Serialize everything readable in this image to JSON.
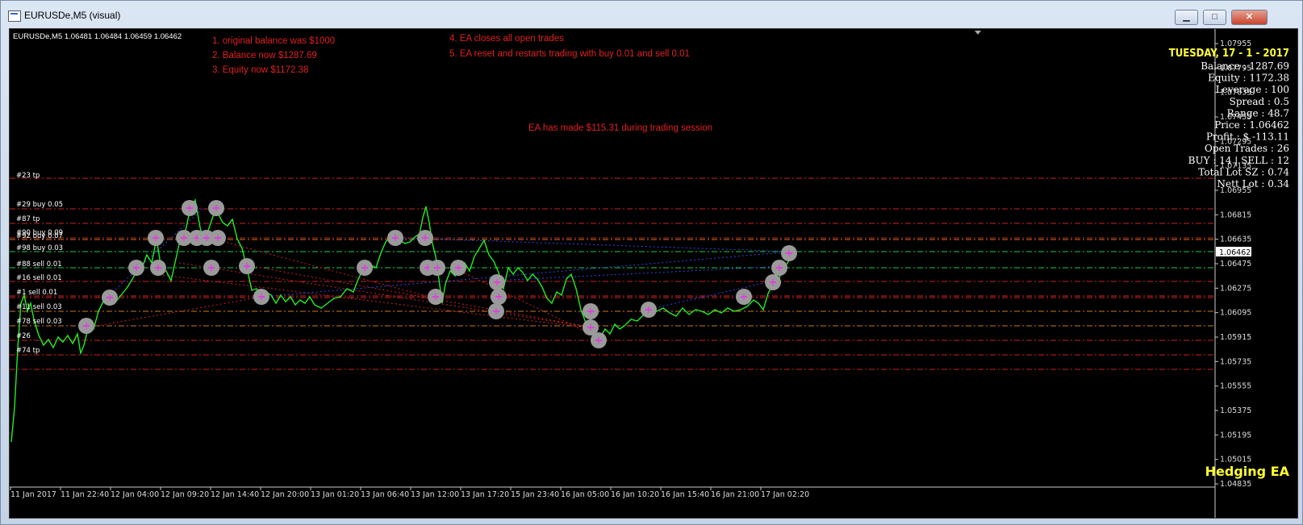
{
  "window": {
    "title": "EURUSDe,M5 (visual)",
    "buttons": {
      "minimize": "▁",
      "maximize": "□",
      "close": "✕"
    }
  },
  "chart": {
    "header": "EURUSDe,M5  1.06481 1.06484 1.06459 1.06462",
    "current_price": "1.06462",
    "y_ticks": [
      "1.07955",
      "1.07795",
      "1.07635",
      "1.07455",
      "1.07295",
      "1.07135",
      "1.06955",
      "1.06815",
      "1.06635",
      "1.06475",
      "1.06275",
      "1.06095",
      "1.05915",
      "1.05735",
      "1.05555",
      "1.05375",
      "1.05195",
      "1.05015",
      "1.04835"
    ],
    "x_ticks": [
      "11 Jan 2017",
      "11 Jan 22:40",
      "12 Jan 04:00",
      "12 Jan 09:20",
      "12 Jan 14:40",
      "12 Jan 20:00",
      "13 Jan 01:20",
      "13 Jan 06:40",
      "13 Jan 12:00",
      "13 Jan 17:20",
      "15 Jan 23:40",
      "16 Jan 05:00",
      "16 Jan 10:20",
      "16 Jan 15:40",
      "16 Jan 21:00",
      "17 Jan 02:20"
    ],
    "order_labels": [
      "#23 tp",
      "#29 buy 0.05",
      "#87 tp",
      "#90 buy 0.09",
      "#92 buy 0.07",
      "#98 buy 0.03",
      "#88 sell 0.01",
      "#16 sell 0.01",
      "#1 sell 0.01",
      "#11 sell 0.03",
      "#78 sell 0.03",
      "#26",
      "#74 tp"
    ],
    "line_colors": {
      "price": "#22ee22",
      "level_red": "#cc2222",
      "level_orange": "#cc7722",
      "level_green": "#22cc44",
      "trade_red": "#cc2222",
      "trade_blue": "#3344ee"
    }
  },
  "annotations": {
    "left": [
      "1. original balance was $1000",
      "2. Balance now  $1287.69",
      "3. Equity now $1172.38"
    ],
    "middle": [
      "4. EA closes all open trades",
      "5. EA reset and restarts trading with buy 0.01 and sell 0.01"
    ],
    "note": "EA has made $115.31 during trading session"
  },
  "info_panel": {
    "date": "TUESDAY, 17 - 1 - 2017",
    "rows": [
      "Balance   : 1287.69",
      "Equity    : 1172.38",
      "Leverage : 100",
      "Spread   : 0.5",
      "Range : 48.7",
      "Price : 1.06462",
      "Profit   : $ -113.11",
      "Open Trades : 26",
      "BUY : 14 | SELL : 12",
      "Total Lot SZ : 0.74",
      "Nett Lot : 0.34"
    ],
    "brand": "Hedging EA"
  }
}
